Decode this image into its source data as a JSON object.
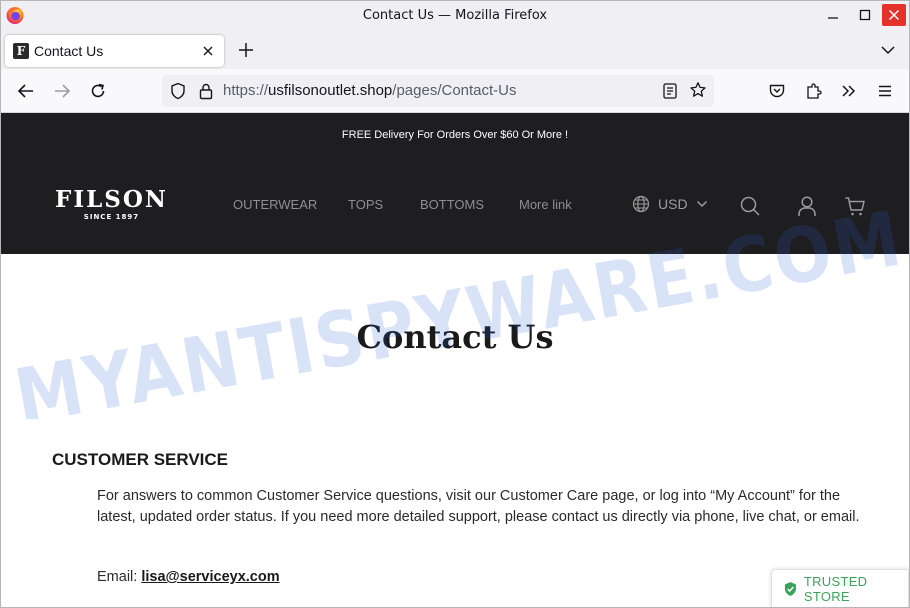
{
  "window": {
    "title": "Contact Us — Mozilla Firefox"
  },
  "tabs": [
    {
      "title": "Contact Us",
      "favicon_letter": "F",
      "active": true
    }
  ],
  "url": {
    "scheme": "https://",
    "host": "usfilsonoutlet.shop",
    "path": "/pages/Contact-Us"
  },
  "site": {
    "announcement": "FREE Delivery For Orders Over $60 Or More !",
    "logo": {
      "name": "FILSON",
      "tagline": "SINCE 1897"
    },
    "menu": [
      "OUTERWEAR",
      "TOPS",
      "BOTTOMS",
      "More link"
    ],
    "currency": "USD",
    "page_title": "Contact Us",
    "section_heading": "CUSTOMER SERVICE",
    "body": "For answers to common Customer Service questions, visit our Customer Care page, or log into “My Account” for the latest, updated order status. If you need more detailed support, please contact us directly via phone, live chat, or email.",
    "email_label": "Email: ",
    "email": "lisa@serviceyx.com"
  },
  "watermark": "MYANTISPYWARE.COM",
  "trust_badge": "TRUSTED STORE",
  "colors": {
    "header_bg": "#1e1d1f",
    "close_button": "#e4322b",
    "trust_green": "#3aa35a",
    "watermark_blue": "#2e63d6"
  },
  "icons": [
    "firefox-logo",
    "minimize-icon",
    "maximize-icon",
    "close-icon",
    "plus-icon",
    "chevron-down-icon",
    "back-arrow-icon",
    "forward-arrow-icon",
    "reload-icon",
    "shield-icon",
    "lock-icon",
    "reader-view-icon",
    "star-icon",
    "pocket-icon",
    "extensions-icon",
    "overflow-icon",
    "hamburger-menu-icon",
    "globe-icon",
    "search-icon",
    "account-icon",
    "cart-icon",
    "shield-check-icon"
  ]
}
